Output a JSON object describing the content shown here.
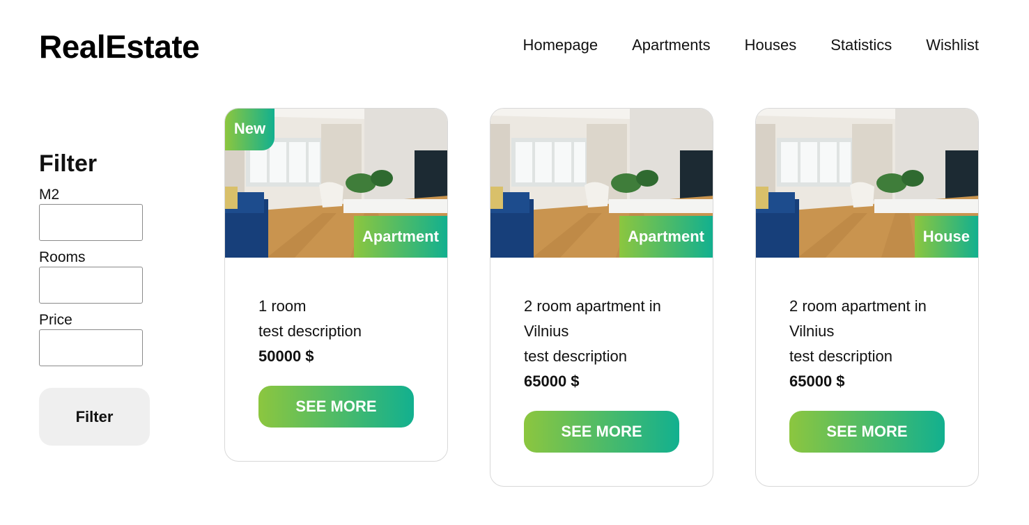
{
  "header": {
    "logo": "RealEstate",
    "nav": [
      "Homepage",
      "Apartments",
      "Houses",
      "Statistics",
      "Wishlist"
    ]
  },
  "filter": {
    "title": "Filter",
    "fields": [
      {
        "label": "M2",
        "value": ""
      },
      {
        "label": "Rooms",
        "value": ""
      },
      {
        "label": "Price",
        "value": ""
      }
    ],
    "button_label": "Filter"
  },
  "listings": [
    {
      "badge": "New",
      "type": "Apartment",
      "title": "1 room",
      "description": "test description",
      "price": "50000 $",
      "button_label": "SEE MORE"
    },
    {
      "badge": "",
      "type": "Apartment",
      "title": "2 room apartment in Vilnius",
      "description": "test description",
      "price": "65000 $",
      "button_label": "SEE MORE"
    },
    {
      "badge": "",
      "type": "House",
      "title": "2 room apartment in Vilnius",
      "description": "test description",
      "price": "65000 $",
      "button_label": "SEE MORE"
    }
  ],
  "colors": {
    "gradient_start": "#8cc63f",
    "gradient_end": "#12b08f",
    "filter_button_bg": "#efefef"
  },
  "icons": {
    "listing_photo": "living-room-photo"
  }
}
